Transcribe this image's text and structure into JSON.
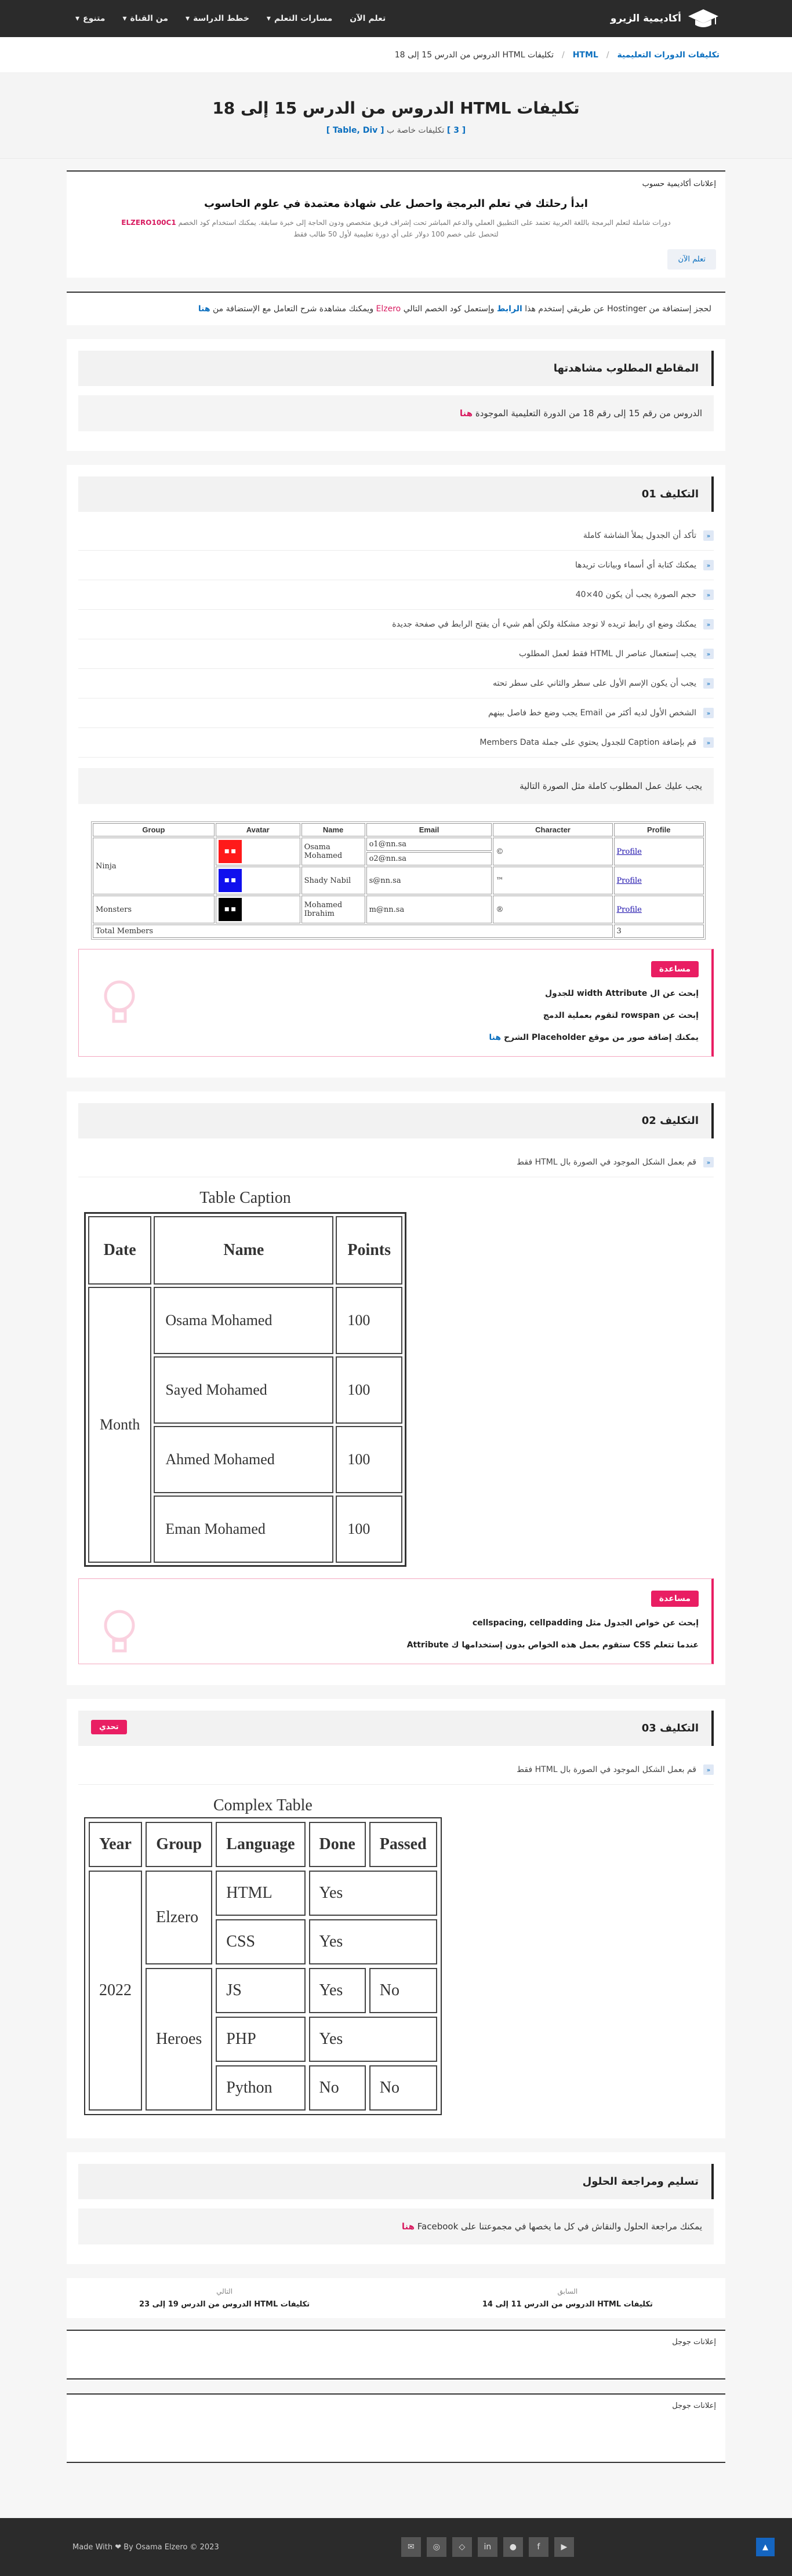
{
  "brand": {
    "name": "أكاديمية الزيرو"
  },
  "nav": [
    "تعلم الآن",
    "مسارات التعلم",
    "خطط الدراسة",
    "من القناة",
    "متنوع"
  ],
  "crumbs": {
    "home": "تكليفات الدورات التعليمية",
    "course": "HTML",
    "current": "تكليفات HTML الدروس من الدرس 15 إلى 18"
  },
  "hero": {
    "title": "تكليفات HTML الدروس من الدرس 15 إلى 18",
    "count": "[ 3 ]",
    "sub": "تكليفات خاصة ب",
    "tags": "[ Table, Div ]"
  },
  "ad": {
    "label": "إعلانات أكاديمية حسوب",
    "title": "ابدأ رحلتك في تعلم البرمجة واحصل على شهادة معتمدة في علوم الحاسوب",
    "text": "دورات شاملة لتعلم البرمجة باللغة العربية تعتمد على التطبيق العملي والدعم المباشر تحت إشراف فريق متخصص ودون الحاجة إلى خبرة سابقة. يمكنك استخدام كود الخصم",
    "code": "ELZERO100C1",
    "text2": "لتحصل على خصم 100 دولار على أي دورة تعليمية لأول 50 طالب فقط",
    "button": "تعلم الآن"
  },
  "host": {
    "a": "لحجز إستضافة من Hostinger عن طريقي إستخدم هذا",
    "link": "الرابط",
    "b": "وإستعمل كود الخصم التالي",
    "code": "Elzero",
    "c": "ويمكنك مشاهدة شرح التعامل مع الإستضافة من",
    "here": "هنا"
  },
  "videos": {
    "title": "المقاطع المطلوب مشاهدتها",
    "text": "الدروس من رقم 15 إلى رقم 18 من الدورة التعليمية الموجودة",
    "link": "هنا"
  },
  "a1": {
    "title": "التكليف 01",
    "tasks": [
      "تأكد أن الجدول يملأ الشاشة كاملة",
      "يمكنك كتابة أي أسماء وبيانات تريدها",
      "حجم الصورة يجب أن يكون 40×40",
      "يمكنك وضع اي رابط تريده لا توجد مشكلة ولكن أهم شيء أن يفتح الرابط في صفحة جديدة",
      "يجب إستعمال عناصر ال HTML فقط لعمل المطلوب",
      "يجب أن يكون الإسم الأول على سطر والثاني على سطر تحته",
      "الشخص الأول لديه أكثر من Email يجب وضع خط فاصل بينهم",
      "قم بإضافة Caption للجدول يحتوي على جملة Members Data"
    ],
    "box": "يجب عليك عمل المطلوب كاملة مثل الصورة التالية",
    "table": {
      "headers": [
        "Group",
        "Avatar",
        "Name",
        "Email",
        "Character",
        "Profile"
      ],
      "g1": "Ninja",
      "g2": "Monsters",
      "r1": {
        "name": "Osama Mohamed",
        "e1": "o1@nn.sa",
        "e2": "o2@nn.sa",
        "ch": "©",
        "p": "Profile"
      },
      "r2": {
        "name": "Shady Nabil",
        "e": "s@nn.sa",
        "ch": "™",
        "p": "Profile"
      },
      "r3": {
        "name": "Mohamed Ibrahim",
        "e": "m@nn.sa",
        "ch": "®",
        "p": "Profile"
      },
      "total": "Total Members",
      "count": "3"
    },
    "help": {
      "tag": "مساعدة",
      "l1": "إبحث عن ال width Attribute للجدول",
      "l2": "إبحث عن rowspan لتقوم بعملية الدمج",
      "l3": "يمكنك إضافة صور من موقع Placeholder الشرح",
      "l3link": "هنا"
    }
  },
  "a2": {
    "title": "التكليف 02",
    "task": "قم بعمل الشكل الموجود في الصورة بال HTML فقط",
    "table": {
      "caption": "Table Caption",
      "headers": [
        "Date",
        "Name",
        "Points"
      ],
      "month": "Month",
      "rows": [
        [
          "Osama Mohamed",
          "100"
        ],
        [
          "Sayed Mohamed",
          "100"
        ],
        [
          "Ahmed Mohamed",
          "100"
        ],
        [
          "Eman Mohamed",
          "100"
        ]
      ]
    },
    "help": {
      "tag": "مساعدة",
      "l1": "إبحث عن خواص الجدول مثل cellspacing, cellpadding",
      "l2": "عندما تتعلم CSS ستقوم بعمل هذه الخواص بدون إستخدامها ك Attribute"
    }
  },
  "a3": {
    "title": "التكليف 03",
    "challenge": "تحدي",
    "task": "قم بعمل الشكل الموجود في الصورة بال HTML فقط",
    "table": {
      "caption": "Complex Table",
      "headers": [
        "Year",
        "Group",
        "Language",
        "Done",
        "Passed"
      ],
      "year": "2022",
      "g1": "Elzero",
      "g2": "Heroes",
      "html": "HTML",
      "css": "CSS",
      "js": "JS",
      "php": "PHP",
      "py": "Python",
      "yes": "Yes",
      "no": "No"
    }
  },
  "submit": {
    "title": "تسليم ومراجعة الحلول",
    "text": "يمكنك مراجعة الحلول والنقاش في كل ما يخصها في مجموعتنا على Facebook",
    "link": "هنا"
  },
  "pager": {
    "prev_cap": "السابق",
    "prev": "تكليفات HTML الدروس من الدرس 11 إلى 14",
    "next_cap": "التالي",
    "next": "تكليفات HTML الدروس من الدرس 19 إلى 23"
  },
  "gads": "إعلانات جوجل",
  "footer": {
    "credit": "Made With ❤ By Osama Elzero © 2023"
  }
}
